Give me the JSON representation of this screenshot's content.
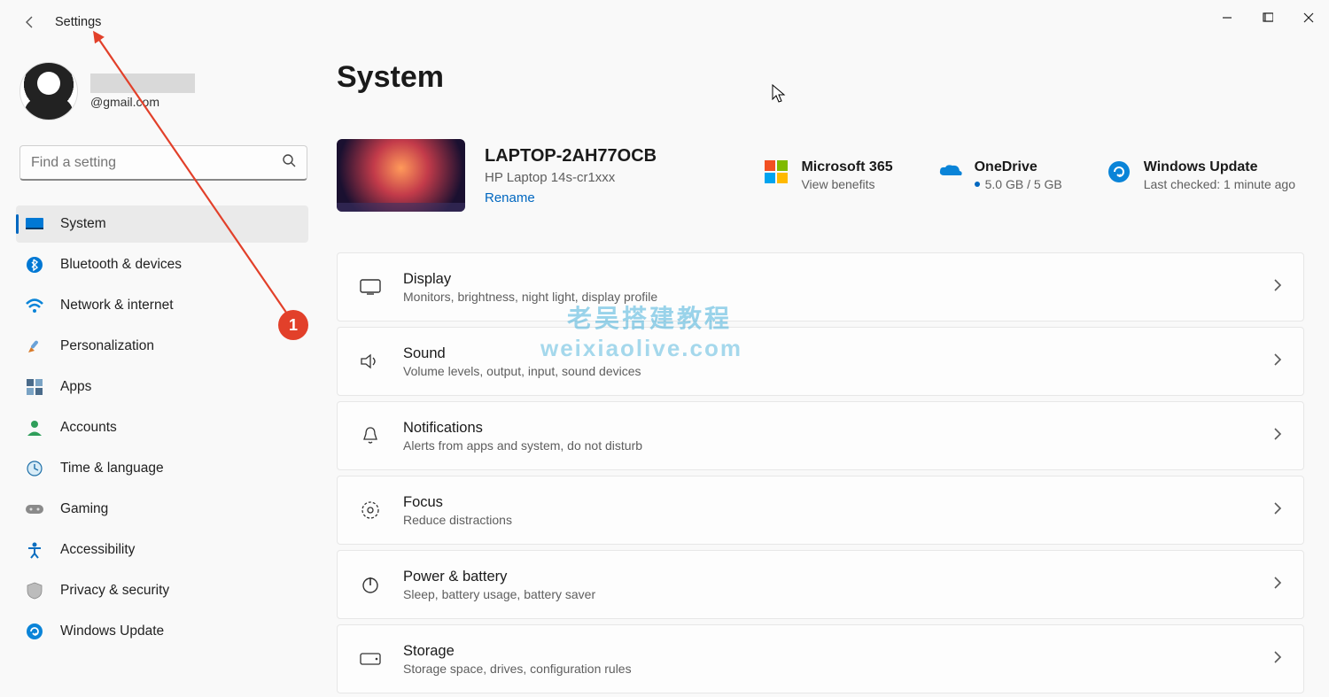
{
  "window": {
    "title": "Settings"
  },
  "user": {
    "email": "@gmail.com"
  },
  "search": {
    "placeholder": "Find a setting"
  },
  "nav": {
    "items": [
      {
        "label": "System"
      },
      {
        "label": "Bluetooth & devices"
      },
      {
        "label": "Network & internet"
      },
      {
        "label": "Personalization"
      },
      {
        "label": "Apps"
      },
      {
        "label": "Accounts"
      },
      {
        "label": "Time & language"
      },
      {
        "label": "Gaming"
      },
      {
        "label": "Accessibility"
      },
      {
        "label": "Privacy & security"
      },
      {
        "label": "Windows Update"
      }
    ]
  },
  "main": {
    "title": "System",
    "device": {
      "name": "LAPTOP-2AH77OCB",
      "model": "HP Laptop 14s-cr1xxx",
      "rename": "Rename"
    },
    "status": {
      "ms365": {
        "title": "Microsoft 365",
        "sub": "View benefits"
      },
      "onedrive": {
        "title": "OneDrive",
        "sub": "5.0 GB / 5 GB"
      },
      "update": {
        "title": "Windows Update",
        "sub": "Last checked: 1 minute ago"
      }
    },
    "rows": [
      {
        "title": "Display",
        "desc": "Monitors, brightness, night light, display profile"
      },
      {
        "title": "Sound",
        "desc": "Volume levels, output, input, sound devices"
      },
      {
        "title": "Notifications",
        "desc": "Alerts from apps and system, do not disturb"
      },
      {
        "title": "Focus",
        "desc": "Reduce distractions"
      },
      {
        "title": "Power & battery",
        "desc": "Sleep, battery usage, battery saver"
      },
      {
        "title": "Storage",
        "desc": "Storage space, drives, configuration rules"
      }
    ]
  },
  "annotation": {
    "badge": "1"
  },
  "watermark": {
    "line1": "老吴搭建教程",
    "line2": "weixiaolive.com"
  }
}
